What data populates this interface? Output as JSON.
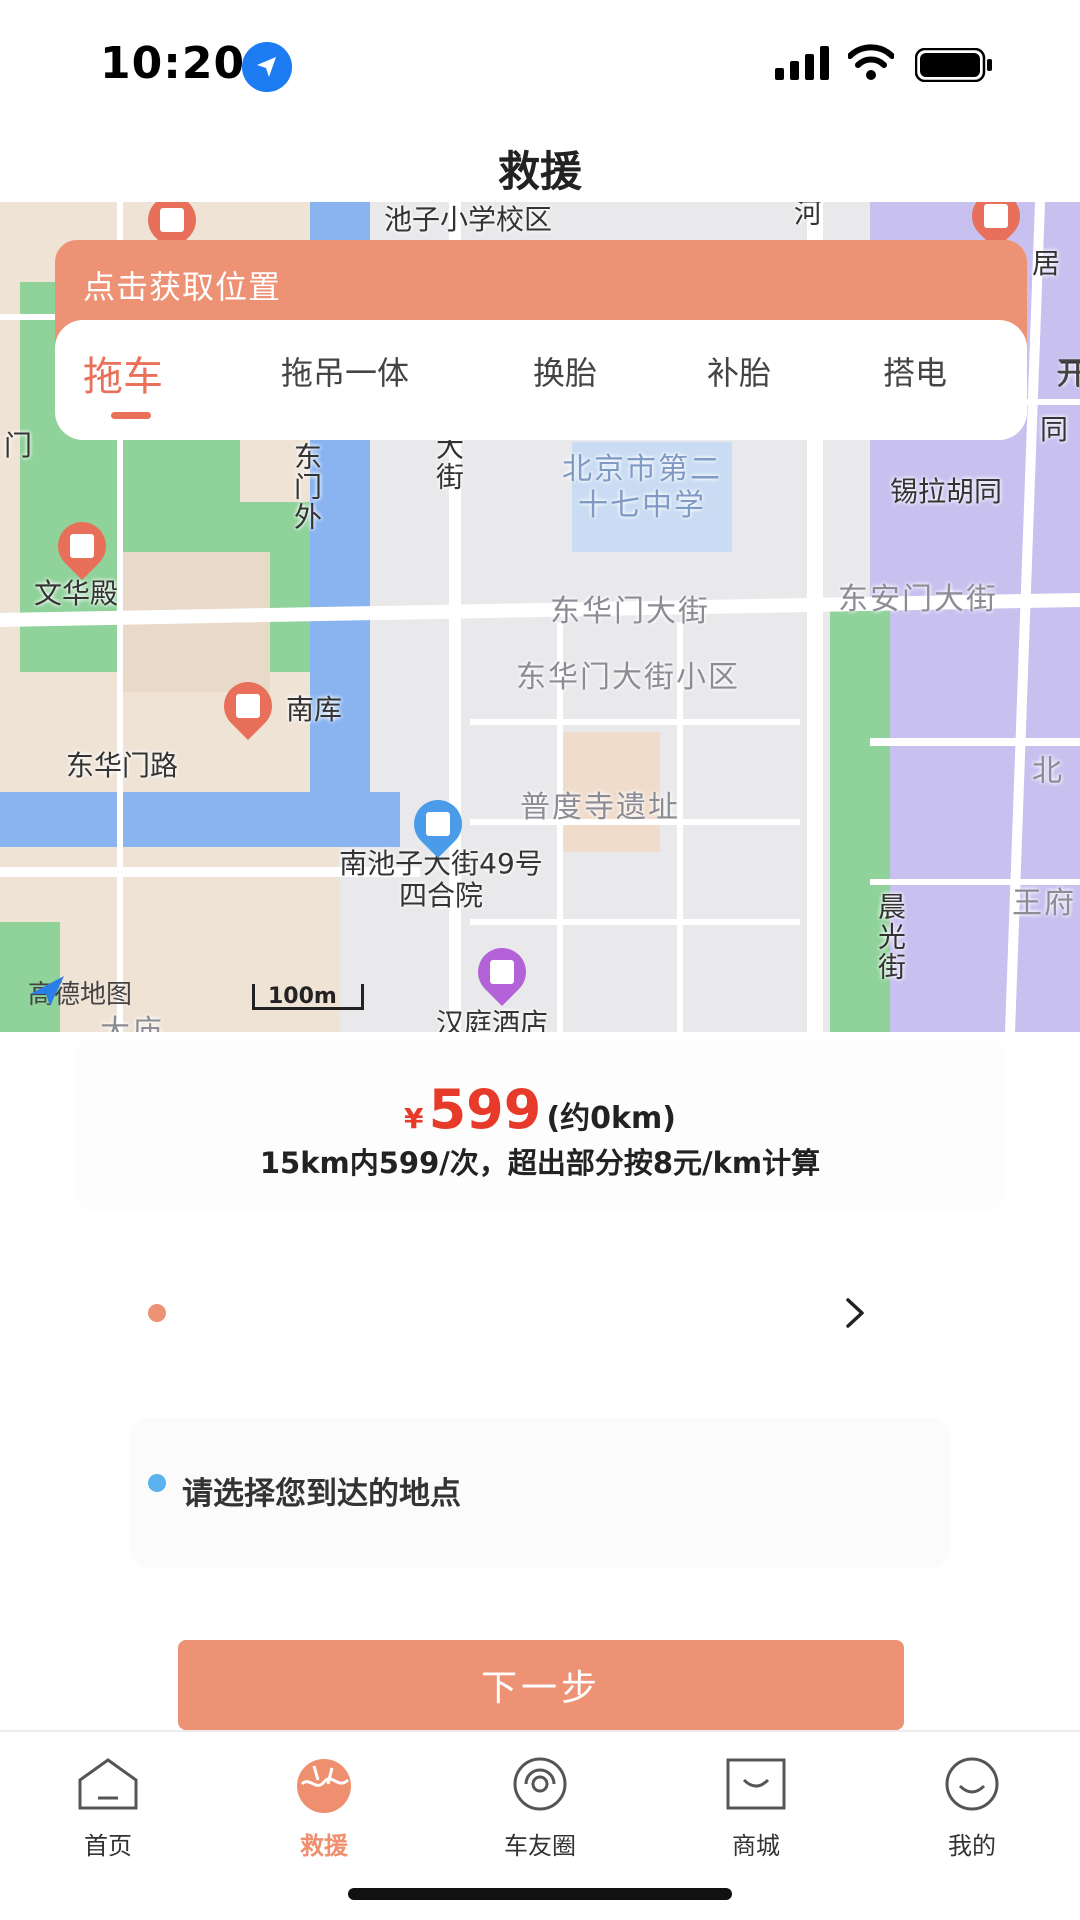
{
  "status_bar": {
    "time": "10:20"
  },
  "header": {
    "title": "救援"
  },
  "map": {
    "labels": {
      "school_top": "池子小学校区",
      "he": "河",
      "ju": "居",
      "men": "门",
      "donghuamenwai": "东门外",
      "dajie": "大街",
      "school27": "北京市第二十七中学",
      "xilahutong": "锡拉胡同",
      "tong": "同",
      "kai": "开",
      "wenhuadian": "文华殿",
      "donghuamendajie": "东华门大街",
      "donganmendajie": "东安门大街",
      "donghuamendajie_xiaoqu": "东华门大街小区",
      "nanku": "南库",
      "donghuamenlu": "东华门路",
      "pudusi": "普度寺遗址",
      "nanchizi": "南池子大街49号四合院",
      "chenguangjie": "晨光街",
      "wangfu": "王府",
      "bei": "北",
      "hanting": "汉庭酒店",
      "damiao": "大庙"
    },
    "logo_text": "高德地图",
    "scale_text": "100m"
  },
  "location_card": {
    "prompt": "点击获取位置",
    "tabs": [
      "拖车",
      "拖吊一体",
      "换胎",
      "补胎",
      "搭电",
      "开"
    ],
    "active_tab": "拖车"
  },
  "price": {
    "symbol": "¥",
    "value": "599",
    "distance": "(约0km)",
    "rule": "15km内599/次，超出部分按8元/km计算"
  },
  "start": {
    "text": ""
  },
  "destination": {
    "placeholder": "请选择您到达的地点"
  },
  "next_button": "下一步",
  "tabbar": {
    "items": [
      {
        "label": "首页",
        "icon": "home-icon"
      },
      {
        "label": "救援",
        "icon": "rescue-icon"
      },
      {
        "label": "车友圈",
        "icon": "community-icon"
      },
      {
        "label": "商城",
        "icon": "mall-icon"
      },
      {
        "label": "我的",
        "icon": "profile-icon"
      }
    ],
    "active": "救援"
  },
  "colors": {
    "accent": "#ee9275",
    "price": "#e83a2a",
    "dest_dot": "#5ab3ef"
  }
}
